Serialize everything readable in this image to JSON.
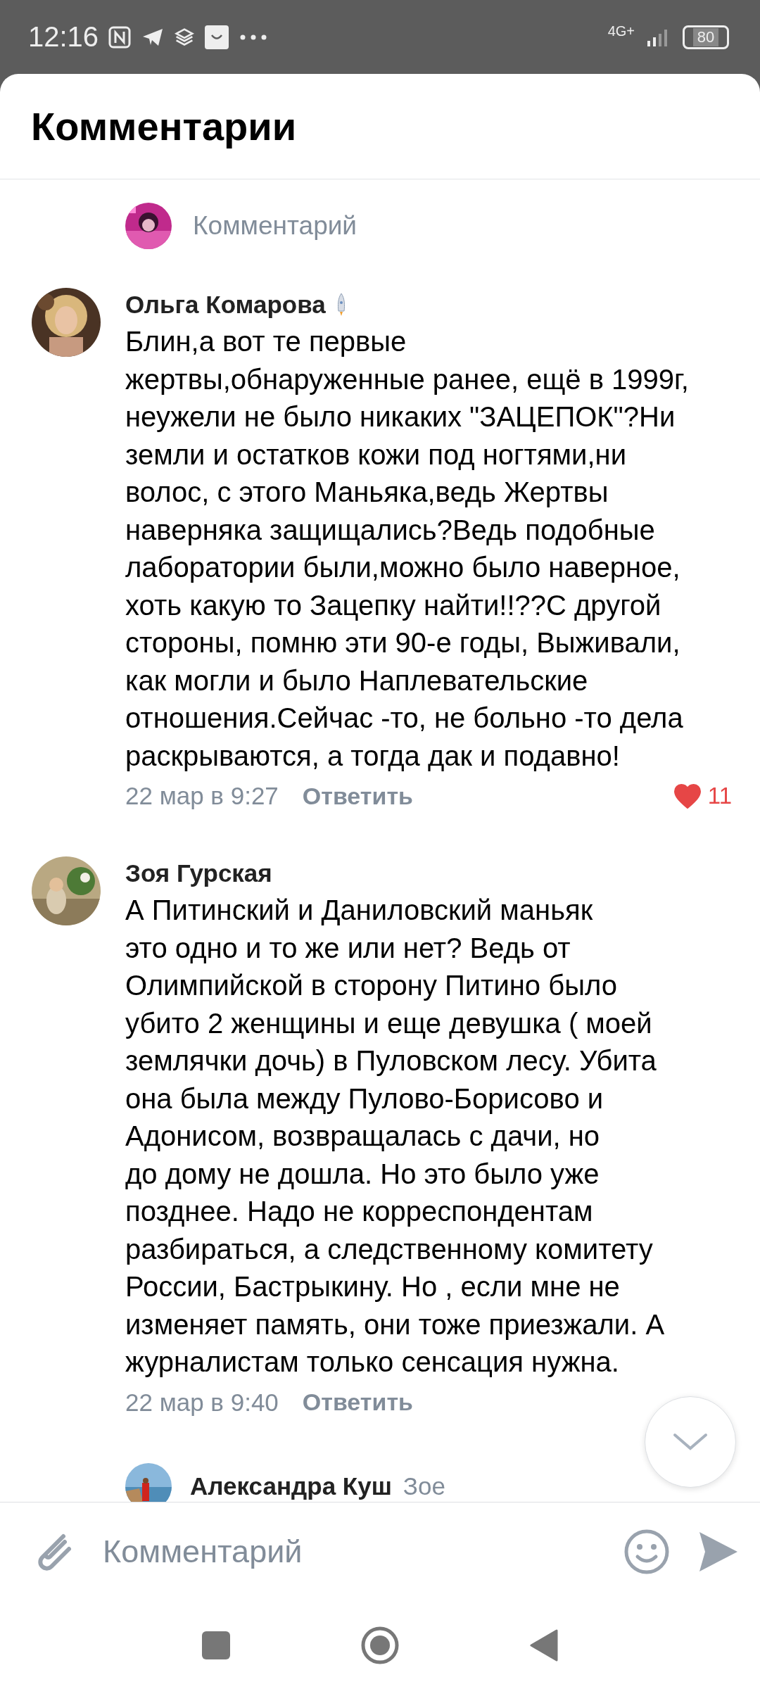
{
  "status_bar": {
    "time": "12:16",
    "network": "4G+",
    "battery": "80"
  },
  "header": {
    "title": "Комментарии"
  },
  "composer_top": {
    "placeholder": "Комментарий"
  },
  "comments": [
    {
      "author": "Ольга Комарова",
      "badge": true,
      "text": "Блин,а вот те первые\nжертвы,обнаруженные ранее, ещё в 1999г,\nнеужели не было никаких \"ЗАЦЕПОК\"?Ни\nземли и остатков кожи под ногтями,ни\nволос, с этого Маньяка,ведь Жертвы\nнаверняка защищались?Ведь подобные\nлаборатории были,можно было наверное,\nхоть какую то Зацепку найти!!??С другой\nстороны, помню эти 90-е годы, Выживали,\nкак могли и было Наплевательские\nотношения.Сейчас -то, не больно -то дела\nраскрываются, а тогда дак и подавно!",
      "date": "22 мар в 9:27",
      "reply": "Ответить",
      "likes": "11",
      "liked": true
    },
    {
      "author": "Зоя Гурская",
      "badge": false,
      "text": "А Питинский и Даниловский маньяк\nэто одно и то же или нет? Ведь от\nОлимпийской в сторону Питино было\nубито 2 женщины и еще девушка ( моей\nземлячки дочь) в Пуловском лесу. Убита\nона была между Пулово-Борисово и\nАдонисом, возвращалась с дачи, но\nдо дому не дошла. Но это было уже\nпозднее. Надо не корреспондентам\nразбираться, а следственному комитету\nРоссии, Бастрыкину.  Но , если мне не\nизменяет память, они тоже приезжали. А\nжурналистам только сенсация нужна.",
      "date": "22 мар в 9:40",
      "reply": "Ответить"
    }
  ],
  "reply_preview": {
    "author": "Александра Куш",
    "reply_to": "Зое"
  },
  "composer": {
    "placeholder": "Комментарий"
  }
}
